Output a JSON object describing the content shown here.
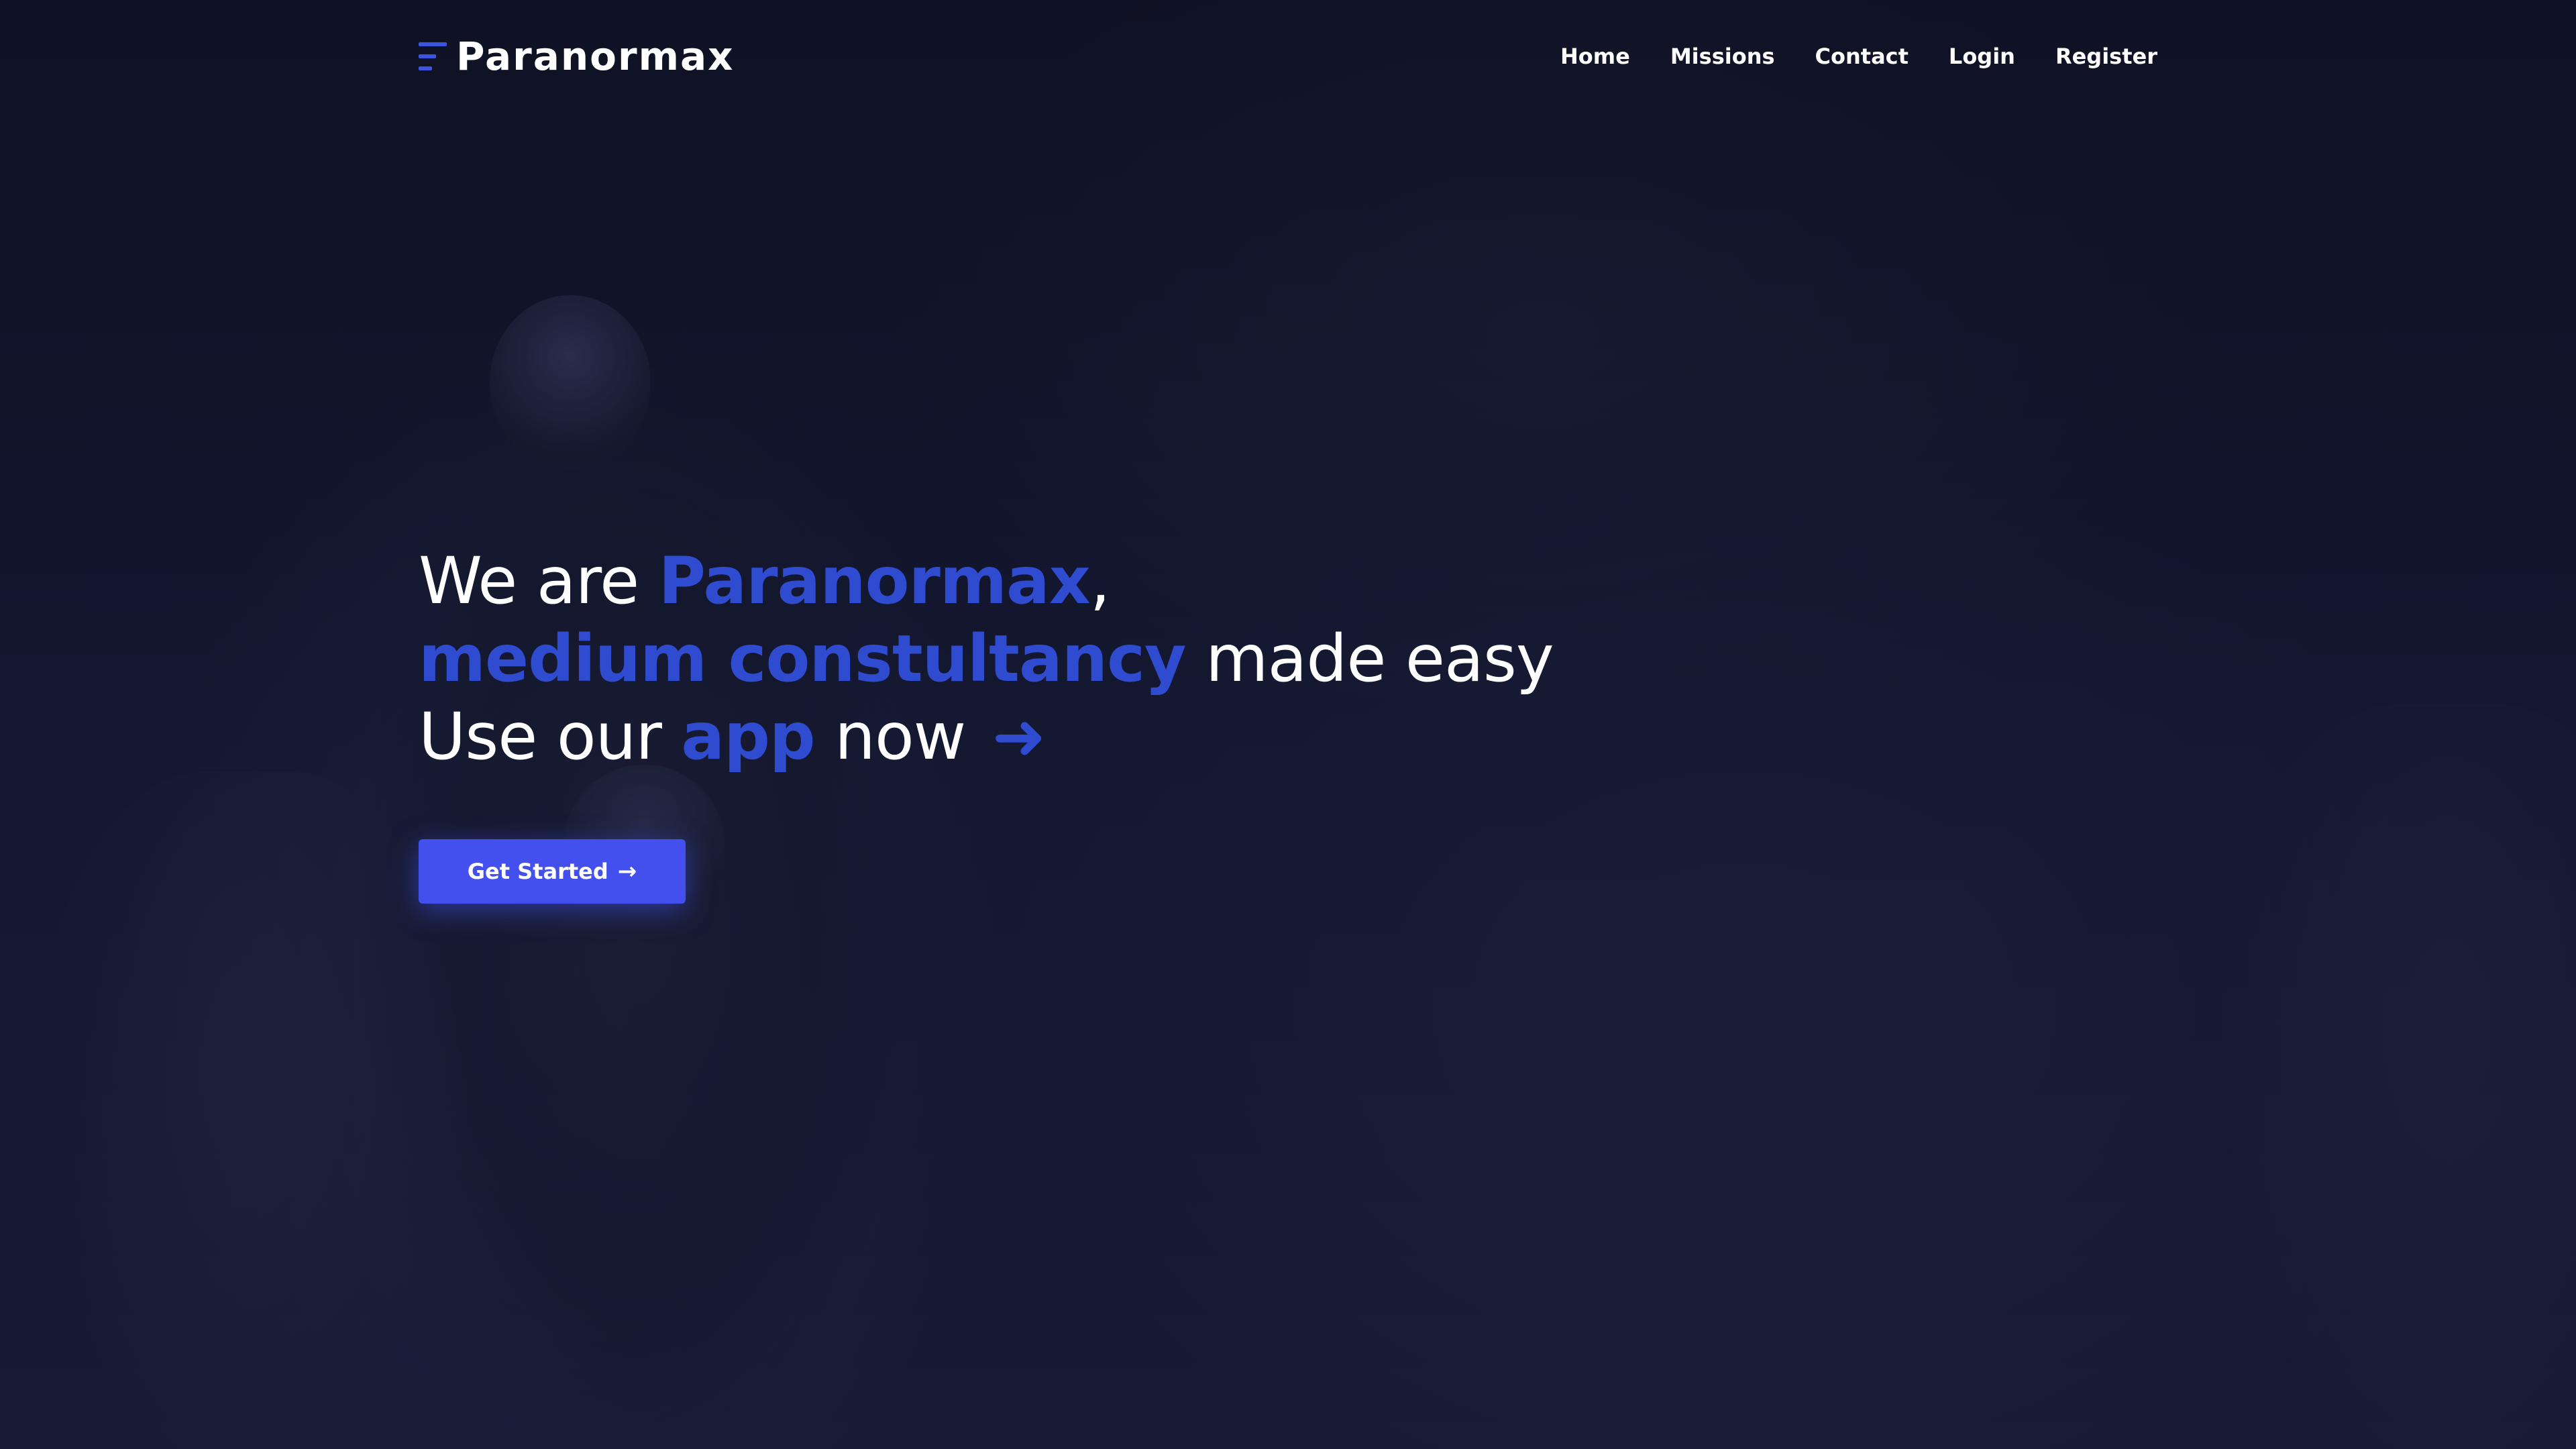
{
  "brand": {
    "name": "Paranormax",
    "icon": "menu-lines-icon"
  },
  "nav": {
    "items": [
      {
        "label": "Home"
      },
      {
        "label": "Missions"
      },
      {
        "label": "Contact"
      },
      {
        "label": "Login"
      },
      {
        "label": "Register"
      }
    ]
  },
  "hero": {
    "line1": {
      "prefix": "We are ",
      "accent": "Paranormax",
      "suffix": ","
    },
    "line2": {
      "accent": "medium constultancy",
      "suffix": " made easy"
    },
    "line3": {
      "prefix": "Use our ",
      "accent": "app",
      "suffix": " now ",
      "arrow": "➜"
    }
  },
  "cta": {
    "label": "Get Started",
    "icon": "arrow-right-icon",
    "icon_glyph": "→"
  },
  "colors": {
    "background": "#12152a",
    "accent": "#2f4bd0",
    "button": "#4450ee",
    "text": "#ffffff"
  }
}
